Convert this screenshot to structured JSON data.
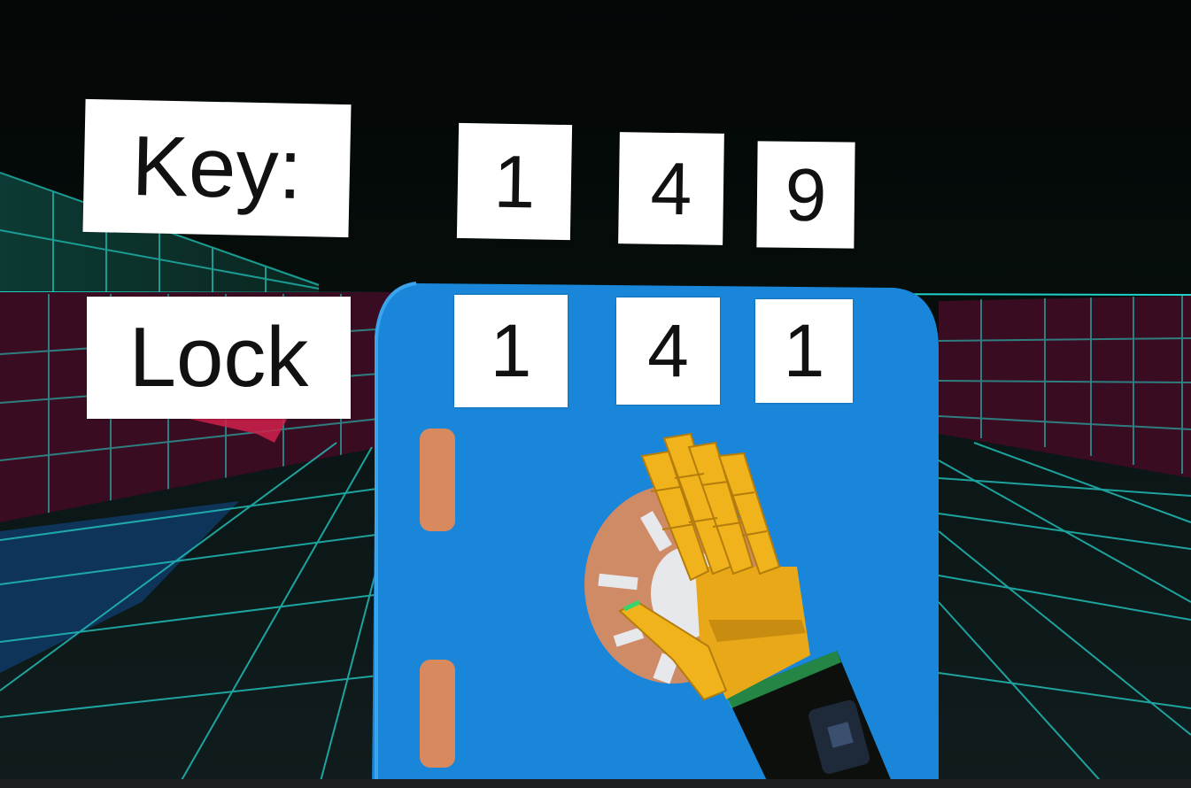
{
  "panel": {
    "key_label": "Key:",
    "lock_label": "Lock",
    "key_digits": [
      "1",
      "4",
      "9"
    ],
    "lock_digits": [
      "1",
      "4",
      "1"
    ]
  },
  "colors": {
    "background": "#060d0a",
    "grid_line": "#22d0c8",
    "wall_fill": "#4a0f2a",
    "safe_body": "#1a86d9",
    "dial": "#cf8a66",
    "hinge": "#d88a5e",
    "hand": "#e8a817",
    "sign_bg": "#ffffff",
    "sign_text": "#111111"
  },
  "objects": {
    "safe": "safe-door",
    "dial": "combination-dial",
    "hand": "vr-hand-controller"
  }
}
